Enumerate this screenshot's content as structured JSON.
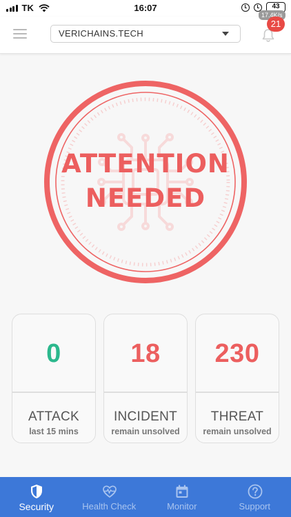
{
  "status_bar": {
    "carrier": "TK",
    "time": "16:07",
    "battery": "43",
    "net_speed": "17.4K/s"
  },
  "header": {
    "menu_icon": "hamburger-menu-icon",
    "selected_domain": "VERICHAINS.TECH",
    "notification_count": "21",
    "bell_icon": "bell-icon"
  },
  "status": {
    "line1": "ATTENTION",
    "line2": "NEEDED",
    "color": "#ec5f5f"
  },
  "cards": [
    {
      "value": "0",
      "title": "ATTACK",
      "subtitle": "last 15 mins",
      "color": "#2cb88d"
    },
    {
      "value": "18",
      "title": "INCIDENT",
      "subtitle": "remain unsolved",
      "color": "#ec5f5f"
    },
    {
      "value": "230",
      "title": "THREAT",
      "subtitle": "remain unsolved",
      "color": "#ec5f5f"
    }
  ],
  "tabs": [
    {
      "label": "Security",
      "icon": "shield-icon",
      "active": true
    },
    {
      "label": "Health Check",
      "icon": "heartbeat-icon",
      "active": false
    },
    {
      "label": "Monitor",
      "icon": "calendar-icon",
      "active": false
    },
    {
      "label": "Support",
      "icon": "question-icon",
      "active": false
    }
  ],
  "colors": {
    "accent": "#3d78d8",
    "alert": "#ec5f5f",
    "good": "#2cb88d"
  }
}
